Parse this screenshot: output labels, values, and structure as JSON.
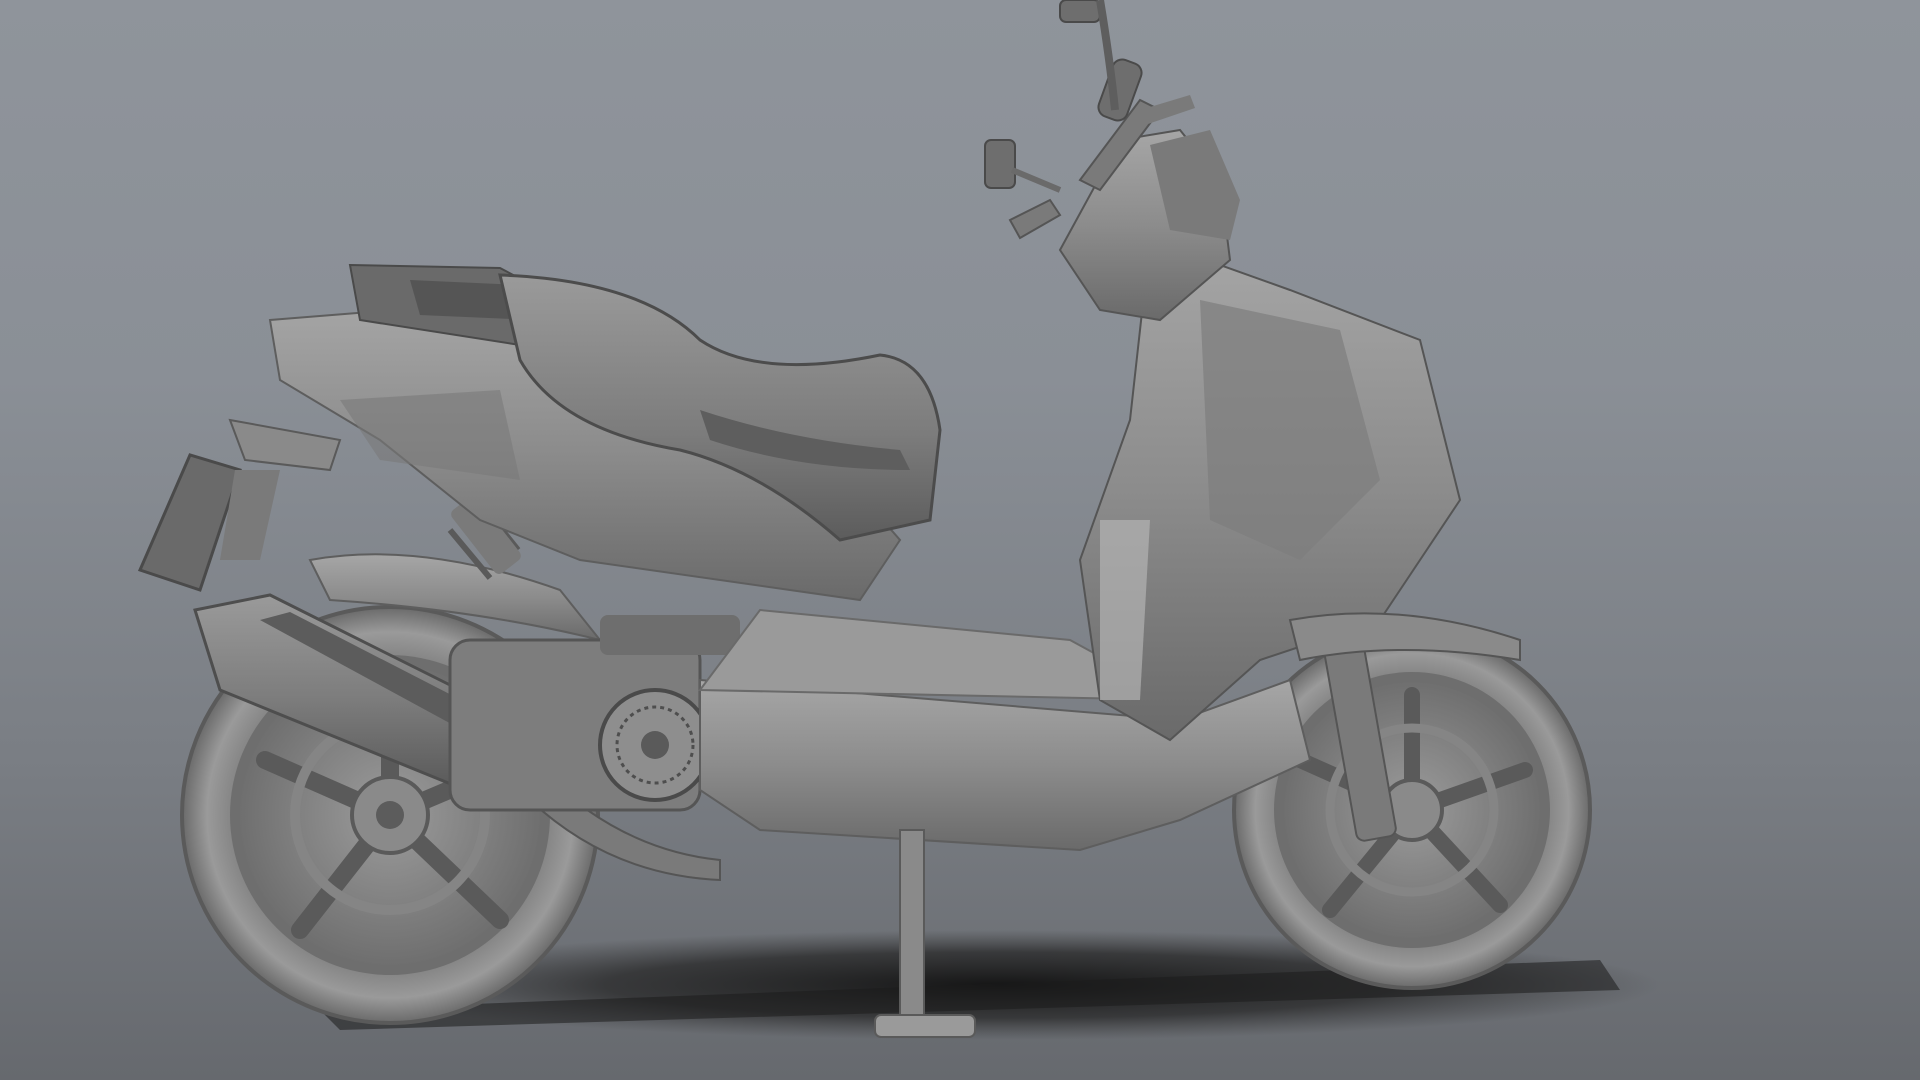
{
  "viewport": {
    "background_top": "#8f949b",
    "background_bottom": "#66696e"
  },
  "model": {
    "material_color": "#8c8c8c",
    "highlight_color": "#bdbdbd",
    "shadow_color": "#4a4a4a",
    "ground_shadow_color": "#1e1e1e"
  }
}
